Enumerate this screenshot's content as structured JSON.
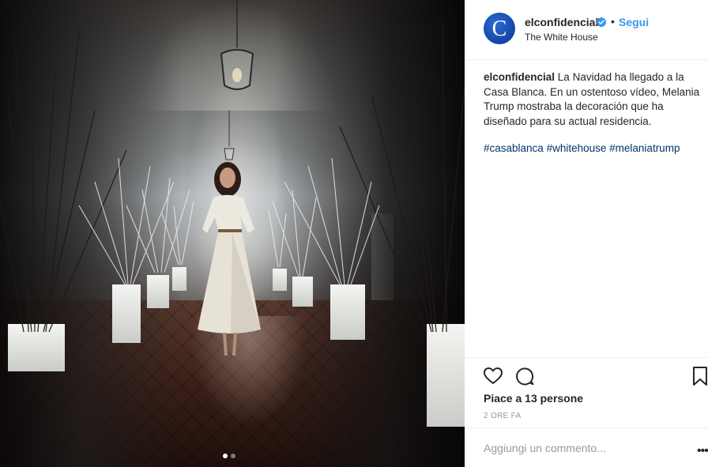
{
  "post": {
    "image_alt": "Photo: woman in a white dress walking down a corridor lined with white branches",
    "carousel": {
      "count": 2,
      "active": 0
    }
  },
  "header": {
    "avatar_letter": "C",
    "username": "elconfidencial",
    "verified": true,
    "separator": "•",
    "follow_label": "Segui",
    "location": "The White House",
    "colors": {
      "follow": "#3897f0",
      "verified": "#3897f0",
      "avatar": "#1a4fb5"
    }
  },
  "caption": {
    "username": "elconfidencial",
    "text": "La Navidad ha llegado a la Casa Blanca. En un ostentoso vídeo, Melania Trump mostraba la decoración que ha diseñado para su actual residencia.",
    "hashtags": [
      "#casablanca",
      "#whitehouse",
      "#melaniatrump"
    ],
    "hashtag_color": "#003569"
  },
  "actions": {
    "icons": {
      "like": "heart-icon",
      "comment": "comment-bubble-icon",
      "save": "bookmark-icon",
      "more": "more-options-icon"
    },
    "likes_text": "Piace a 13 persone",
    "timestamp": "2 ORE FA"
  },
  "comment": {
    "placeholder": "Aggiungi un commento...",
    "more_label": "•••"
  }
}
